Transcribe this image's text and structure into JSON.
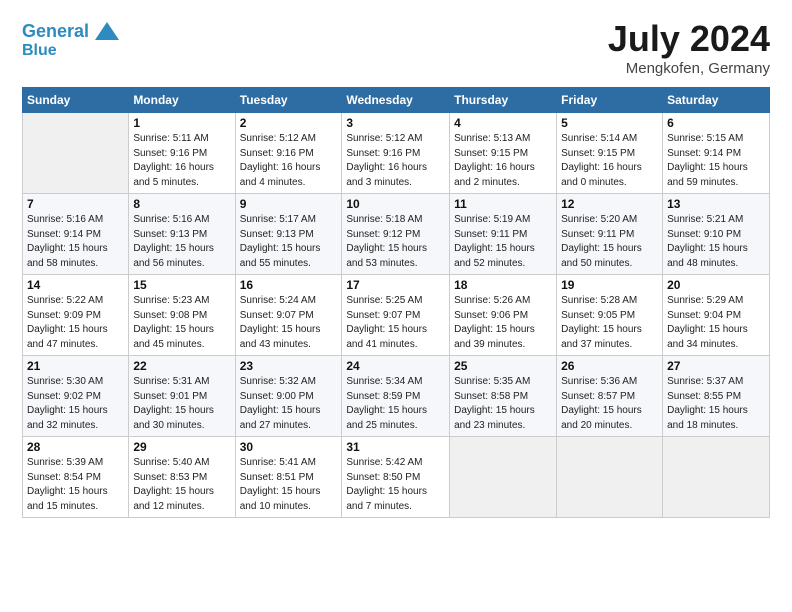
{
  "header": {
    "logo_line1": "General",
    "logo_line2": "Blue",
    "title": "July 2024",
    "subtitle": "Mengkofen, Germany"
  },
  "days_of_week": [
    "Sunday",
    "Monday",
    "Tuesday",
    "Wednesday",
    "Thursday",
    "Friday",
    "Saturday"
  ],
  "weeks": [
    [
      {
        "day": "",
        "info": ""
      },
      {
        "day": "1",
        "info": "Sunrise: 5:11 AM\nSunset: 9:16 PM\nDaylight: 16 hours\nand 5 minutes."
      },
      {
        "day": "2",
        "info": "Sunrise: 5:12 AM\nSunset: 9:16 PM\nDaylight: 16 hours\nand 4 minutes."
      },
      {
        "day": "3",
        "info": "Sunrise: 5:12 AM\nSunset: 9:16 PM\nDaylight: 16 hours\nand 3 minutes."
      },
      {
        "day": "4",
        "info": "Sunrise: 5:13 AM\nSunset: 9:15 PM\nDaylight: 16 hours\nand 2 minutes."
      },
      {
        "day": "5",
        "info": "Sunrise: 5:14 AM\nSunset: 9:15 PM\nDaylight: 16 hours\nand 0 minutes."
      },
      {
        "day": "6",
        "info": "Sunrise: 5:15 AM\nSunset: 9:14 PM\nDaylight: 15 hours\nand 59 minutes."
      }
    ],
    [
      {
        "day": "7",
        "info": "Sunrise: 5:16 AM\nSunset: 9:14 PM\nDaylight: 15 hours\nand 58 minutes."
      },
      {
        "day": "8",
        "info": "Sunrise: 5:16 AM\nSunset: 9:13 PM\nDaylight: 15 hours\nand 56 minutes."
      },
      {
        "day": "9",
        "info": "Sunrise: 5:17 AM\nSunset: 9:13 PM\nDaylight: 15 hours\nand 55 minutes."
      },
      {
        "day": "10",
        "info": "Sunrise: 5:18 AM\nSunset: 9:12 PM\nDaylight: 15 hours\nand 53 minutes."
      },
      {
        "day": "11",
        "info": "Sunrise: 5:19 AM\nSunset: 9:11 PM\nDaylight: 15 hours\nand 52 minutes."
      },
      {
        "day": "12",
        "info": "Sunrise: 5:20 AM\nSunset: 9:11 PM\nDaylight: 15 hours\nand 50 minutes."
      },
      {
        "day": "13",
        "info": "Sunrise: 5:21 AM\nSunset: 9:10 PM\nDaylight: 15 hours\nand 48 minutes."
      }
    ],
    [
      {
        "day": "14",
        "info": "Sunrise: 5:22 AM\nSunset: 9:09 PM\nDaylight: 15 hours\nand 47 minutes."
      },
      {
        "day": "15",
        "info": "Sunrise: 5:23 AM\nSunset: 9:08 PM\nDaylight: 15 hours\nand 45 minutes."
      },
      {
        "day": "16",
        "info": "Sunrise: 5:24 AM\nSunset: 9:07 PM\nDaylight: 15 hours\nand 43 minutes."
      },
      {
        "day": "17",
        "info": "Sunrise: 5:25 AM\nSunset: 9:07 PM\nDaylight: 15 hours\nand 41 minutes."
      },
      {
        "day": "18",
        "info": "Sunrise: 5:26 AM\nSunset: 9:06 PM\nDaylight: 15 hours\nand 39 minutes."
      },
      {
        "day": "19",
        "info": "Sunrise: 5:28 AM\nSunset: 9:05 PM\nDaylight: 15 hours\nand 37 minutes."
      },
      {
        "day": "20",
        "info": "Sunrise: 5:29 AM\nSunset: 9:04 PM\nDaylight: 15 hours\nand 34 minutes."
      }
    ],
    [
      {
        "day": "21",
        "info": "Sunrise: 5:30 AM\nSunset: 9:02 PM\nDaylight: 15 hours\nand 32 minutes."
      },
      {
        "day": "22",
        "info": "Sunrise: 5:31 AM\nSunset: 9:01 PM\nDaylight: 15 hours\nand 30 minutes."
      },
      {
        "day": "23",
        "info": "Sunrise: 5:32 AM\nSunset: 9:00 PM\nDaylight: 15 hours\nand 27 minutes."
      },
      {
        "day": "24",
        "info": "Sunrise: 5:34 AM\nSunset: 8:59 PM\nDaylight: 15 hours\nand 25 minutes."
      },
      {
        "day": "25",
        "info": "Sunrise: 5:35 AM\nSunset: 8:58 PM\nDaylight: 15 hours\nand 23 minutes."
      },
      {
        "day": "26",
        "info": "Sunrise: 5:36 AM\nSunset: 8:57 PM\nDaylight: 15 hours\nand 20 minutes."
      },
      {
        "day": "27",
        "info": "Sunrise: 5:37 AM\nSunset: 8:55 PM\nDaylight: 15 hours\nand 18 minutes."
      }
    ],
    [
      {
        "day": "28",
        "info": "Sunrise: 5:39 AM\nSunset: 8:54 PM\nDaylight: 15 hours\nand 15 minutes."
      },
      {
        "day": "29",
        "info": "Sunrise: 5:40 AM\nSunset: 8:53 PM\nDaylight: 15 hours\nand 12 minutes."
      },
      {
        "day": "30",
        "info": "Sunrise: 5:41 AM\nSunset: 8:51 PM\nDaylight: 15 hours\nand 10 minutes."
      },
      {
        "day": "31",
        "info": "Sunrise: 5:42 AM\nSunset: 8:50 PM\nDaylight: 15 hours\nand 7 minutes."
      },
      {
        "day": "",
        "info": ""
      },
      {
        "day": "",
        "info": ""
      },
      {
        "day": "",
        "info": ""
      }
    ]
  ]
}
